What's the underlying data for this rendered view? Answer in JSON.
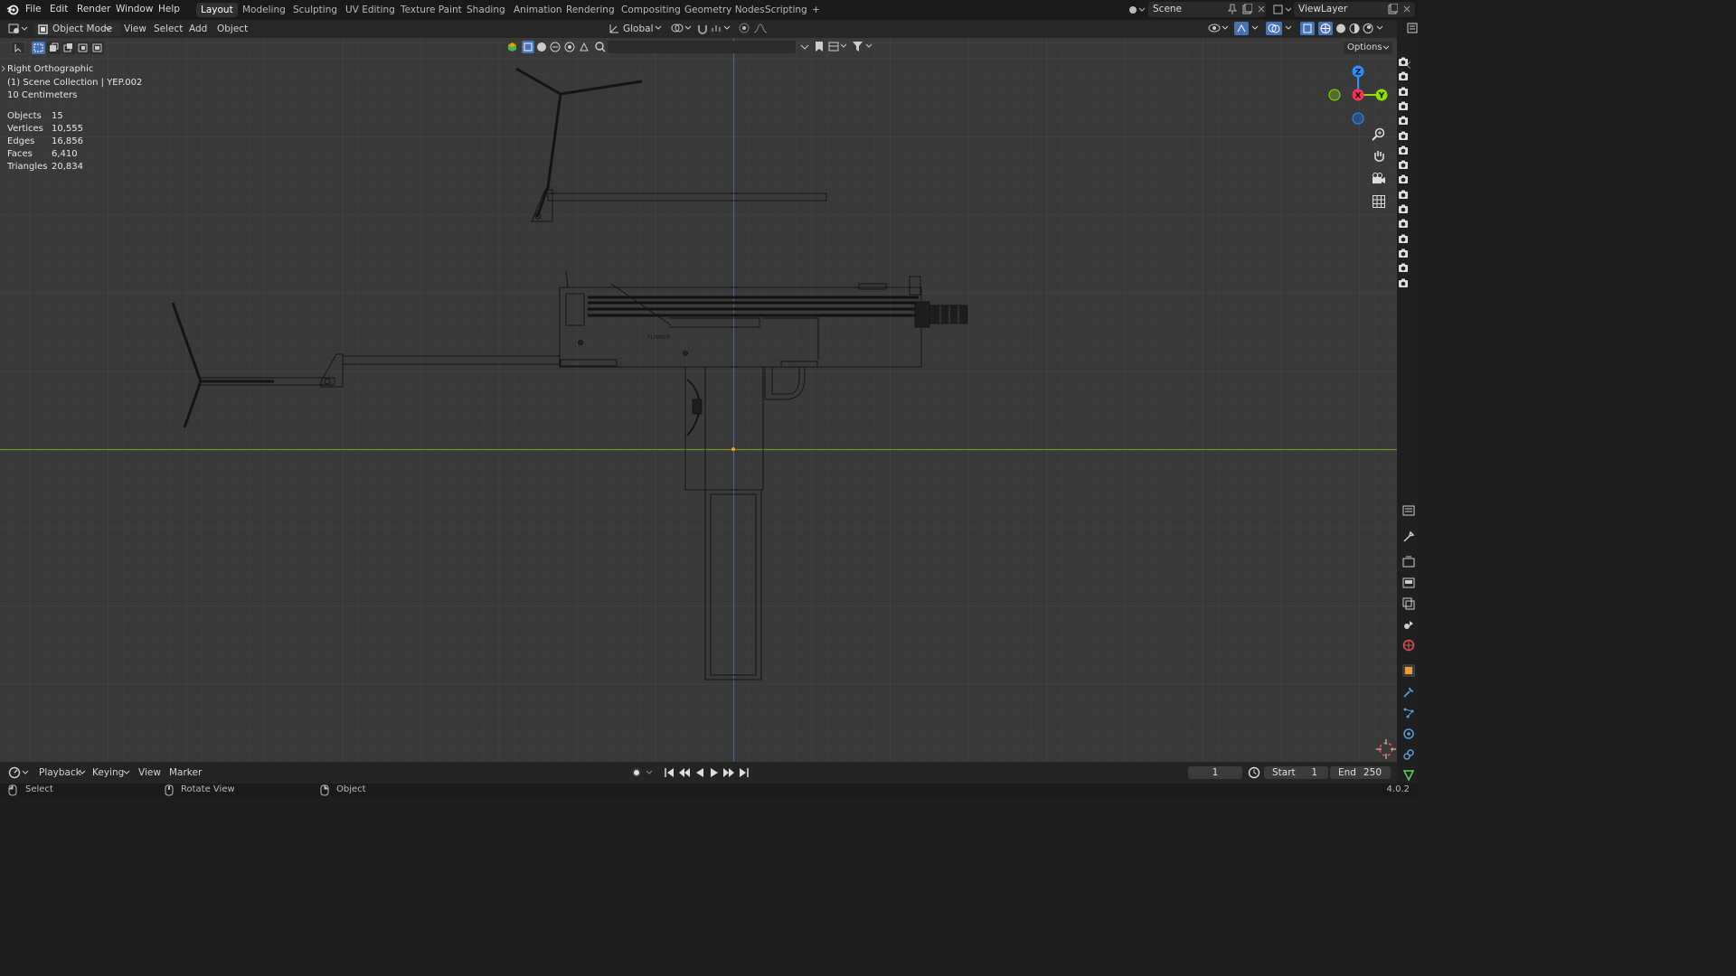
{
  "top_menu": {
    "file": "File",
    "edit": "Edit",
    "render": "Render",
    "window": "Window",
    "help": "Help"
  },
  "workspaces": [
    "Layout",
    "Modeling",
    "Sculpting",
    "UV Editing",
    "Texture Paint",
    "Shading",
    "Animation",
    "Rendering",
    "Compositing",
    "Geometry Nodes",
    "Scripting"
  ],
  "add_workspace": "+",
  "scene": {
    "name": "Scene"
  },
  "view_layer": {
    "name": "ViewLayer"
  },
  "viewport_header": {
    "mode": "Object Mode",
    "view": "View",
    "select": "Select",
    "add": "Add",
    "object": "Object",
    "orientation": "Global",
    "options": "Options"
  },
  "overlay_info": {
    "view_name": "Right Orthographic",
    "collection": "(1) Scene Collection | YEP.002",
    "scale": "10 Centimeters"
  },
  "stats": [
    {
      "label": "Objects",
      "value": "15"
    },
    {
      "label": "Vertices",
      "value": "10,555"
    },
    {
      "label": "Edges",
      "value": "16,856"
    },
    {
      "label": "Faces",
      "value": "6,410"
    },
    {
      "label": "Triangles",
      "value": "20,834"
    }
  ],
  "gizmo": {
    "z": "Z",
    "x": "X",
    "y": "Y"
  },
  "model_label": "FLMAKER",
  "timeline": {
    "playback": "Playback",
    "keying": "Keying",
    "view": "View",
    "marker": "Marker",
    "current_frame": "1",
    "start_label": "Start",
    "start": "1",
    "end_label": "End",
    "end": "250"
  },
  "statusbar": {
    "select": "Select",
    "rotate": "Rotate View",
    "object": "Object",
    "version": "4.0.2"
  },
  "colors": {
    "axis_x": "#ff3352",
    "axis_y": "#8bdc00",
    "axis_z": "#2890ff",
    "y_line": "#6e8f2a",
    "z_line": "#2a69b5",
    "grid": "#414141"
  }
}
